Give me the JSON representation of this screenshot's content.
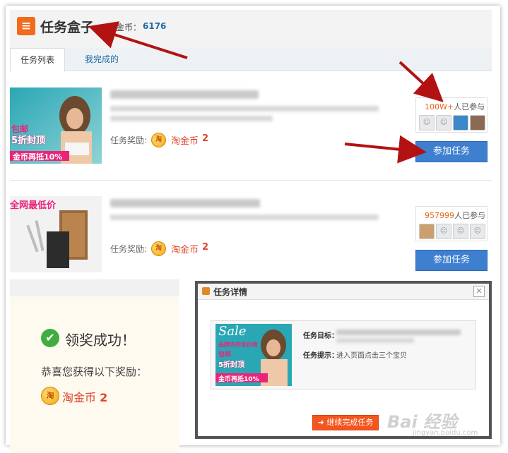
{
  "header": {
    "title": "任务盒子",
    "coin_label": "淘金币：",
    "coin_value": "6176",
    "logo_glyph": "≡"
  },
  "tabs": [
    {
      "label": "任务列表",
      "active": true
    },
    {
      "label": "我完成的",
      "active": false
    }
  ],
  "tasks": [
    {
      "banner_lines": [
        "包邮",
        "5折封顶",
        "金币再抵10%"
      ],
      "reward_label": "任务奖励:",
      "reward_name": "淘金币",
      "reward_amount": "2",
      "participants_count": "100W+",
      "participants_text": "人已参与",
      "join_label": "参加任务"
    },
    {
      "banner_lines": [
        "全网最低价"
      ],
      "reward_label": "任务奖励:",
      "reward_name": "淘金币",
      "reward_amount": "2",
      "participants_count": "957999",
      "participants_text": "人已参与",
      "join_label": "参加任务"
    }
  ],
  "success_panel": {
    "title": "领奖成功！",
    "message": "恭喜您获得以下奖励：",
    "reward_name": "淘金币",
    "reward_amount": "2"
  },
  "dialog": {
    "title": "任务详情",
    "close_glyph": "✕",
    "banner_lines": [
      "Sale",
      "品牌内衣低价抢",
      "包邮",
      "5折封顶",
      "金币再抵10%"
    ],
    "goal_label": "任务目标：",
    "hint_label": "任务提示：",
    "hint_value": "进入页面点击三个宝贝",
    "continue_label": "➜ 继续完成任务"
  },
  "coin_glyph": "淘",
  "watermark": {
    "main": "Bai 经验",
    "sub": "jingyan.baidu.com"
  },
  "colors": {
    "accent": "#3f7fd0",
    "reward": "#e0432a",
    "orange": "#f26b1c",
    "continue": "#f4551e"
  }
}
